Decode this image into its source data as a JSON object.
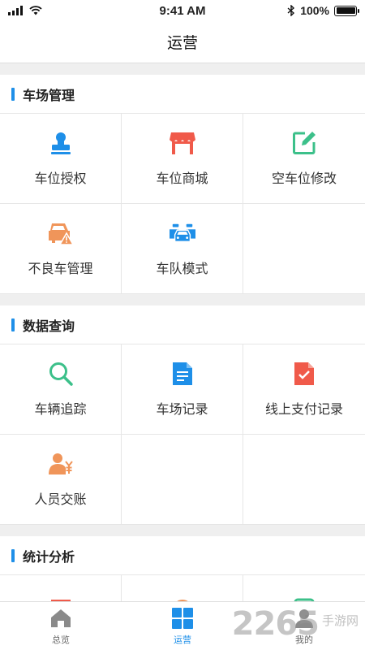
{
  "status_bar": {
    "time": "9:41 AM",
    "battery": "100%"
  },
  "nav": {
    "title": "运营"
  },
  "colors": {
    "accent": "#1e8fe8",
    "red": "#f05a4a",
    "green": "#3cc08a",
    "orange": "#f0955a"
  },
  "sections": [
    {
      "title": "车场管理",
      "items": [
        {
          "label": "车位授权",
          "icon": "stamp-icon"
        },
        {
          "label": "车位商城",
          "icon": "shop-icon"
        },
        {
          "label": "空车位修改",
          "icon": "edit-icon"
        },
        {
          "label": "不良车管理",
          "icon": "car-warning-icon"
        },
        {
          "label": "车队模式",
          "icon": "car-fleet-icon"
        }
      ]
    },
    {
      "title": "数据查询",
      "items": [
        {
          "label": "车辆追踪",
          "icon": "search-icon"
        },
        {
          "label": "车场记录",
          "icon": "document-icon"
        },
        {
          "label": "线上支付记录",
          "icon": "payment-record-icon"
        },
        {
          "label": "人员交账",
          "icon": "person-yen-icon"
        }
      ]
    },
    {
      "title": "统计分析",
      "items": []
    }
  ],
  "tabs": [
    {
      "label": "总览",
      "icon": "home-icon"
    },
    {
      "label": "运营",
      "icon": "grid-icon"
    },
    {
      "label": "我的",
      "icon": "user-icon"
    }
  ],
  "watermark": {
    "number": "2265",
    "text": "手游网"
  }
}
